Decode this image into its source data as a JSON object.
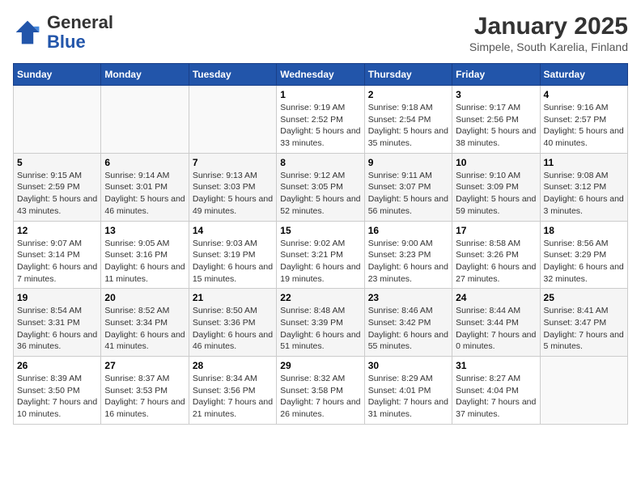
{
  "header": {
    "logo_general": "General",
    "logo_blue": "Blue",
    "month_title": "January 2025",
    "subtitle": "Simpele, South Karelia, Finland"
  },
  "weekdays": [
    "Sunday",
    "Monday",
    "Tuesday",
    "Wednesday",
    "Thursday",
    "Friday",
    "Saturday"
  ],
  "weeks": [
    [
      {
        "day": "",
        "info": ""
      },
      {
        "day": "",
        "info": ""
      },
      {
        "day": "",
        "info": ""
      },
      {
        "day": "1",
        "info": "Sunrise: 9:19 AM\nSunset: 2:52 PM\nDaylight: 5 hours and 33 minutes."
      },
      {
        "day": "2",
        "info": "Sunrise: 9:18 AM\nSunset: 2:54 PM\nDaylight: 5 hours and 35 minutes."
      },
      {
        "day": "3",
        "info": "Sunrise: 9:17 AM\nSunset: 2:56 PM\nDaylight: 5 hours and 38 minutes."
      },
      {
        "day": "4",
        "info": "Sunrise: 9:16 AM\nSunset: 2:57 PM\nDaylight: 5 hours and 40 minutes."
      }
    ],
    [
      {
        "day": "5",
        "info": "Sunrise: 9:15 AM\nSunset: 2:59 PM\nDaylight: 5 hours and 43 minutes."
      },
      {
        "day": "6",
        "info": "Sunrise: 9:14 AM\nSunset: 3:01 PM\nDaylight: 5 hours and 46 minutes."
      },
      {
        "day": "7",
        "info": "Sunrise: 9:13 AM\nSunset: 3:03 PM\nDaylight: 5 hours and 49 minutes."
      },
      {
        "day": "8",
        "info": "Sunrise: 9:12 AM\nSunset: 3:05 PM\nDaylight: 5 hours and 52 minutes."
      },
      {
        "day": "9",
        "info": "Sunrise: 9:11 AM\nSunset: 3:07 PM\nDaylight: 5 hours and 56 minutes."
      },
      {
        "day": "10",
        "info": "Sunrise: 9:10 AM\nSunset: 3:09 PM\nDaylight: 5 hours and 59 minutes."
      },
      {
        "day": "11",
        "info": "Sunrise: 9:08 AM\nSunset: 3:12 PM\nDaylight: 6 hours and 3 minutes."
      }
    ],
    [
      {
        "day": "12",
        "info": "Sunrise: 9:07 AM\nSunset: 3:14 PM\nDaylight: 6 hours and 7 minutes."
      },
      {
        "day": "13",
        "info": "Sunrise: 9:05 AM\nSunset: 3:16 PM\nDaylight: 6 hours and 11 minutes."
      },
      {
        "day": "14",
        "info": "Sunrise: 9:03 AM\nSunset: 3:19 PM\nDaylight: 6 hours and 15 minutes."
      },
      {
        "day": "15",
        "info": "Sunrise: 9:02 AM\nSunset: 3:21 PM\nDaylight: 6 hours and 19 minutes."
      },
      {
        "day": "16",
        "info": "Sunrise: 9:00 AM\nSunset: 3:23 PM\nDaylight: 6 hours and 23 minutes."
      },
      {
        "day": "17",
        "info": "Sunrise: 8:58 AM\nSunset: 3:26 PM\nDaylight: 6 hours and 27 minutes."
      },
      {
        "day": "18",
        "info": "Sunrise: 8:56 AM\nSunset: 3:29 PM\nDaylight: 6 hours and 32 minutes."
      }
    ],
    [
      {
        "day": "19",
        "info": "Sunrise: 8:54 AM\nSunset: 3:31 PM\nDaylight: 6 hours and 36 minutes."
      },
      {
        "day": "20",
        "info": "Sunrise: 8:52 AM\nSunset: 3:34 PM\nDaylight: 6 hours and 41 minutes."
      },
      {
        "day": "21",
        "info": "Sunrise: 8:50 AM\nSunset: 3:36 PM\nDaylight: 6 hours and 46 minutes."
      },
      {
        "day": "22",
        "info": "Sunrise: 8:48 AM\nSunset: 3:39 PM\nDaylight: 6 hours and 51 minutes."
      },
      {
        "day": "23",
        "info": "Sunrise: 8:46 AM\nSunset: 3:42 PM\nDaylight: 6 hours and 55 minutes."
      },
      {
        "day": "24",
        "info": "Sunrise: 8:44 AM\nSunset: 3:44 PM\nDaylight: 7 hours and 0 minutes."
      },
      {
        "day": "25",
        "info": "Sunrise: 8:41 AM\nSunset: 3:47 PM\nDaylight: 7 hours and 5 minutes."
      }
    ],
    [
      {
        "day": "26",
        "info": "Sunrise: 8:39 AM\nSunset: 3:50 PM\nDaylight: 7 hours and 10 minutes."
      },
      {
        "day": "27",
        "info": "Sunrise: 8:37 AM\nSunset: 3:53 PM\nDaylight: 7 hours and 16 minutes."
      },
      {
        "day": "28",
        "info": "Sunrise: 8:34 AM\nSunset: 3:56 PM\nDaylight: 7 hours and 21 minutes."
      },
      {
        "day": "29",
        "info": "Sunrise: 8:32 AM\nSunset: 3:58 PM\nDaylight: 7 hours and 26 minutes."
      },
      {
        "day": "30",
        "info": "Sunrise: 8:29 AM\nSunset: 4:01 PM\nDaylight: 7 hours and 31 minutes."
      },
      {
        "day": "31",
        "info": "Sunrise: 8:27 AM\nSunset: 4:04 PM\nDaylight: 7 hours and 37 minutes."
      },
      {
        "day": "",
        "info": ""
      }
    ]
  ]
}
